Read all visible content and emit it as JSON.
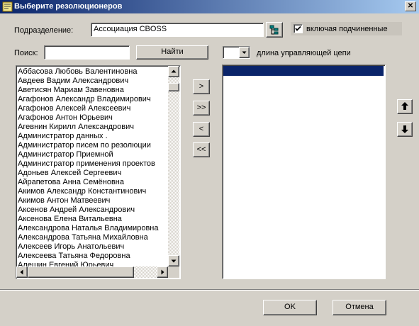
{
  "window": {
    "title": "Выберите резолюционеров"
  },
  "department": {
    "label": "Подразделение:",
    "value": "Ассоциация CBOSS"
  },
  "include_sub": {
    "label": "включая подчиненные",
    "checked": true
  },
  "search": {
    "label": "Поиск:",
    "value": "",
    "button": "Найти"
  },
  "chain": {
    "value": "",
    "label": "длина управляющей цепи"
  },
  "people": [
    "Аббасова Любовь Валентиновна",
    "Авдеев Вадим Александрович",
    "Аветисян Мариам Завеновна",
    "Агафонов Александр Владимирович",
    "Агафонов Алексей Алексеевич",
    "Агафонов Антон Юрьевич",
    "Агевнин Кирилл Александрович",
    "Администратор данных .",
    "Администратор писем по резолюции",
    "Администратор Приемной",
    "Администратор применения проектов",
    "Адоньев Алексей Сергеевич",
    "Айрапетова Анна Семёновна",
    "Акимов Александр Константинович",
    "Акимов Антон Матвеевич",
    "Аксенов Андрей Александрович",
    "Аксенова Елена Витальевна",
    "Александрова Наталья Владимировна",
    "Александрова Татьяна Михайловна",
    "Алексеев Игорь Анатольевич",
    "Алексеева Татьяна Федоровна",
    "Алешин Евгений Юрьевич"
  ],
  "transfer": {
    "add": ">",
    "add_all": ">>",
    "remove": "<",
    "remove_all": "<<"
  },
  "buttons": {
    "ok": "OK",
    "cancel": "Отмена"
  },
  "icons": {
    "tree": "tree-icon",
    "up": "arrow-up-icon",
    "down": "arrow-down-icon"
  },
  "colors": {
    "selection": "#0a246a",
    "title_start": "#0a246a",
    "title_end": "#a6caf0"
  }
}
